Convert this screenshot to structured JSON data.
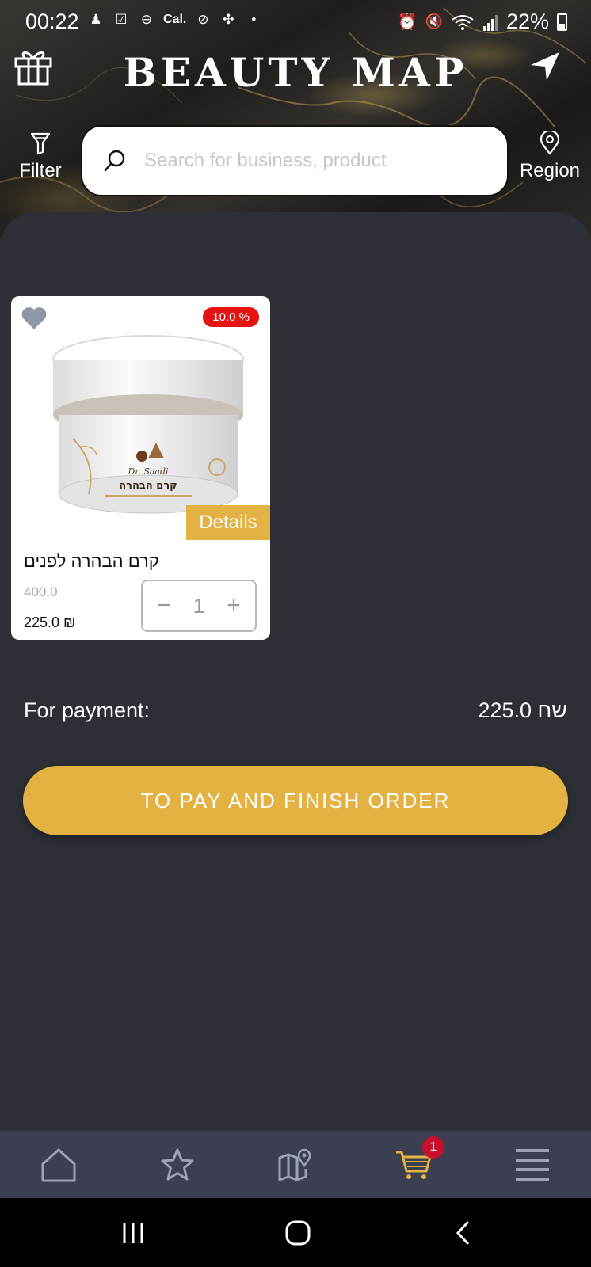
{
  "status_bar": {
    "time": "00:22",
    "carrier_label": "Cal.",
    "battery": "22%"
  },
  "header": {
    "title": "BEAUTY MAP"
  },
  "search": {
    "filter_label": "Filter",
    "placeholder": "Search for business, product",
    "region_label": "Region"
  },
  "cart": {
    "items": [
      {
        "name": "קרם הבהרה לפנים",
        "image_label_brand": "Dr. Saadi",
        "image_label_product": "קרם הבהרה",
        "discount": "10.0 %",
        "old_price": "400.0",
        "new_price": "225.0 ₪",
        "quantity": "1",
        "details_label": "Details"
      }
    ],
    "payment_label": "For payment:",
    "payment_value": "225.0 שח",
    "finish_label": "TO PAY AND FINISH ORDER"
  },
  "bottom_nav": {
    "cart_count": "1",
    "items": [
      "home-icon",
      "star-icon",
      "map-icon",
      "cart-icon",
      "menu-icon"
    ],
    "active_color": "#e2b245"
  },
  "colors": {
    "accent": "#e2b245",
    "background": "#2c2f35",
    "badge_red": "#e61313"
  }
}
